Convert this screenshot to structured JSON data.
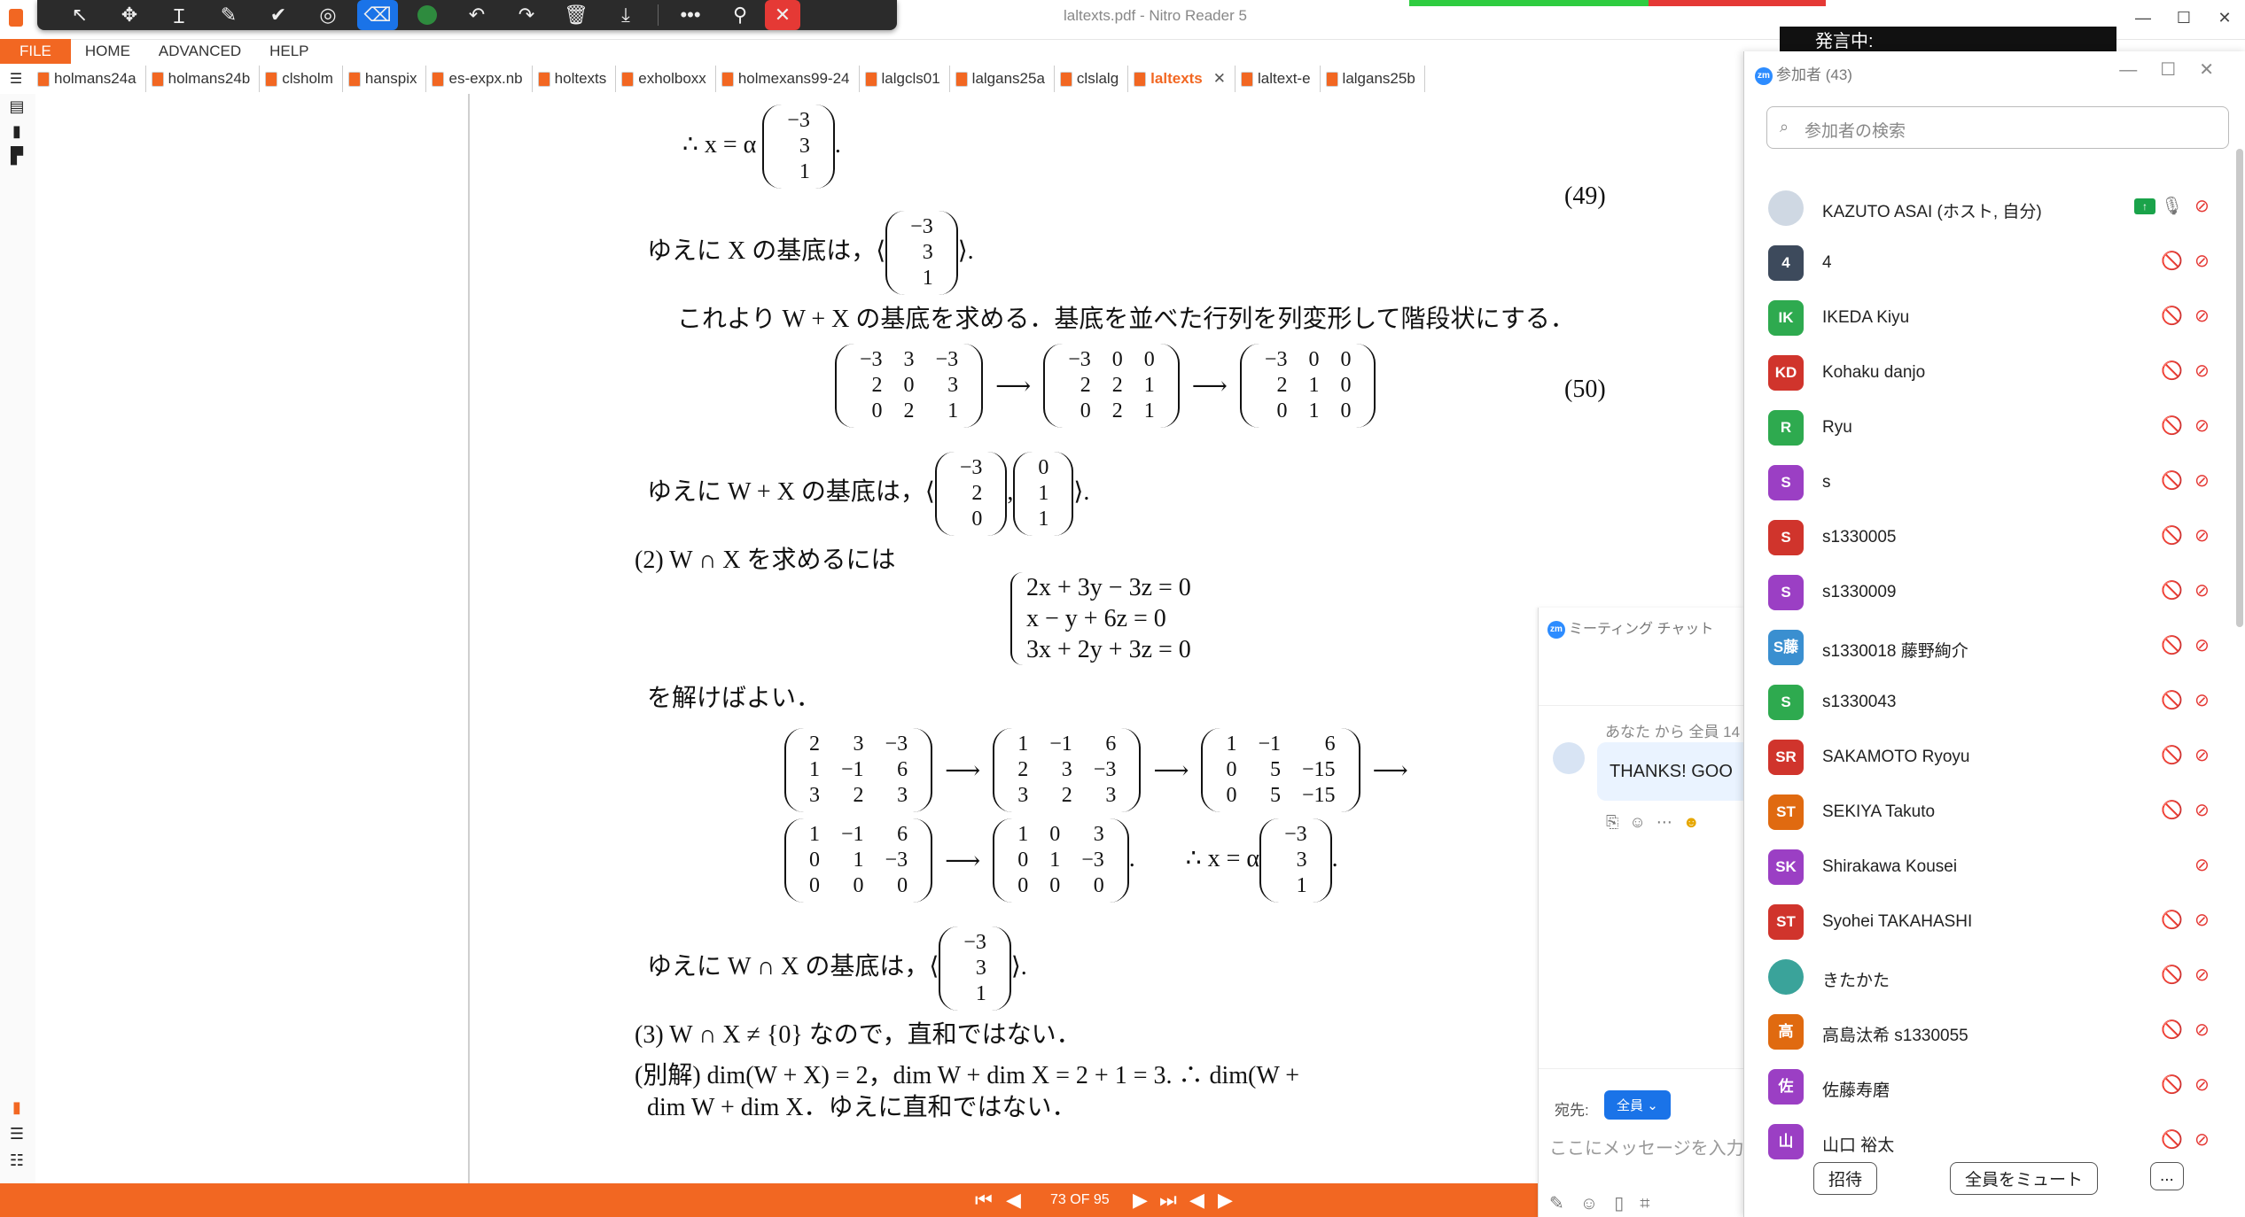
{
  "app": {
    "title": "laltexts.pdf - Nitro Reader 5"
  },
  "menu": [
    "FILE",
    "HOME",
    "ADVANCED",
    "HELP"
  ],
  "tabs": [
    "holmans24a",
    "holmans24b",
    "clsholm",
    "hanspix",
    "es-expx.nb",
    "holtexts",
    "exholboxx",
    "holmexans99-24",
    "lalgcls01",
    "lalgans25a",
    "clslalg",
    "laltexts",
    "laltext-e",
    "lalgans25b"
  ],
  "active_tab": "laltexts",
  "speaker_banner": "発言中:",
  "document": {
    "line1": "∴ x = α",
    "vec_a": [
      "−3",
      "3",
      "1"
    ],
    "eq49": "(49)",
    "line2": "ゆえに X の基底は，⟨",
    "line2_end": "⟩.",
    "line3": "これより W + X の基底を求める．基底を並べた行列を列変形して階段状にする．",
    "m1": [
      [
        "−3",
        "3",
        "−3"
      ],
      [
        "2",
        "0",
        "3"
      ],
      [
        "0",
        "2",
        "1"
      ]
    ],
    "m2": [
      [
        "−3",
        "0",
        "0"
      ],
      [
        "2",
        "2",
        "1"
      ],
      [
        "0",
        "2",
        "1"
      ]
    ],
    "m3": [
      [
        "−3",
        "0",
        "0"
      ],
      [
        "2",
        "1",
        "0"
      ],
      [
        "0",
        "1",
        "0"
      ]
    ],
    "eq50": "(50)",
    "line4": "ゆえに W + X の基底は，⟨",
    "vec_b": [
      "−3",
      "2",
      "0"
    ],
    "vec_c": [
      "0",
      "1",
      "1"
    ],
    "line4_end": "⟩.",
    "line5": "(2) W ∩ X を求めるには",
    "sys": [
      "2x + 3y − 3z = 0",
      "x − y + 6z = 0",
      "3x + 2y + 3z = 0"
    ],
    "line6": "を解けばよい．",
    "r1": [
      [
        "2",
        "3",
        "−3"
      ],
      [
        "1",
        "−1",
        "6"
      ],
      [
        "3",
        "2",
        "3"
      ]
    ],
    "r2": [
      [
        "1",
        "−1",
        "6"
      ],
      [
        "2",
        "3",
        "−3"
      ],
      [
        "3",
        "2",
        "3"
      ]
    ],
    "r3": [
      [
        "1",
        "−1",
        "6"
      ],
      [
        "0",
        "5",
        "−15"
      ],
      [
        "0",
        "5",
        "−15"
      ]
    ],
    "r4": [
      [
        "1",
        "−1",
        "6"
      ],
      [
        "0",
        "1",
        "−3"
      ],
      [
        "0",
        "0",
        "0"
      ]
    ],
    "r5": [
      [
        "1",
        "0",
        "3"
      ],
      [
        "0",
        "1",
        "−3"
      ],
      [
        "0",
        "0",
        "0"
      ]
    ],
    "line7_mid": "∴ x = α",
    "vec_d": [
      "−3",
      "3",
      "1"
    ],
    "line8": "ゆえに W ∩ X の基底は，⟨",
    "vec_e": [
      "−3",
      "3",
      "1"
    ],
    "line8_end": "⟩.",
    "line9": "(3) W ∩ X ≠ {0} なので，直和ではない．",
    "line10": "(別解) dim(W + X) = 2，dim W + dim X = 2 + 1 = 3.   ∴ dim(W +",
    "line11": "dim W + dim X．ゆえに直和ではない．"
  },
  "status": {
    "page": "73 OF 95"
  },
  "chat": {
    "title": "ミーティング チャット",
    "from": "あなた から 全員 14",
    "message": "THANKS! GOO",
    "to_label": "宛先:",
    "to_value": "全員",
    "input_placeholder": "ここにメッセージを入力..."
  },
  "participants": {
    "title": "参加者 (43)",
    "search_placeholder": "参加者の検索",
    "list": [
      {
        "initials": "",
        "name": "KAZUTO ASAI (ホスト, 自分)",
        "color": "#cfd8e3",
        "photo": true
      },
      {
        "initials": "4",
        "name": "4",
        "color": "#3d4a5c"
      },
      {
        "initials": "IK",
        "name": "IKEDA Kiyu",
        "color": "#2eaa4f"
      },
      {
        "initials": "KD",
        "name": "Kohaku danjo",
        "color": "#d0342c"
      },
      {
        "initials": "R",
        "name": "Ryu",
        "color": "#2eaa4f"
      },
      {
        "initials": "S",
        "name": "s",
        "color": "#9b3fc4"
      },
      {
        "initials": "S",
        "name": "s1330005",
        "color": "#d0342c"
      },
      {
        "initials": "S",
        "name": "s1330009",
        "color": "#9b3fc4"
      },
      {
        "initials": "S藤",
        "name": "s1330018 藤野絢介",
        "color": "#3a8fd0"
      },
      {
        "initials": "S",
        "name": "s1330043",
        "color": "#2eaa4f"
      },
      {
        "initials": "SR",
        "name": "SAKAMOTO Ryoyu",
        "color": "#d0342c"
      },
      {
        "initials": "ST",
        "name": "SEKIYA Takuto",
        "color": "#e06a10"
      },
      {
        "initials": "SK",
        "name": "Shirakawa Kousei",
        "color": "#9b3fc4"
      },
      {
        "initials": "ST",
        "name": "Syohei TAKAHASHI",
        "color": "#d0342c"
      },
      {
        "initials": "",
        "name": "きたかた",
        "color": "#3aa39a",
        "photo": true
      },
      {
        "initials": "高",
        "name": "高島汰希 s1330055",
        "color": "#e06a10"
      },
      {
        "initials": "佐",
        "name": "佐藤寿磨",
        "color": "#9b3fc4"
      },
      {
        "initials": "山",
        "name": "山口 裕太",
        "color": "#9b3fc4"
      }
    ],
    "invite": "招待",
    "mute_all": "全員をミュート",
    "more": "..."
  },
  "colors": {
    "accent": "#f26722",
    "zoom_blue": "#1a73e8",
    "muted_red": "#e53935"
  }
}
